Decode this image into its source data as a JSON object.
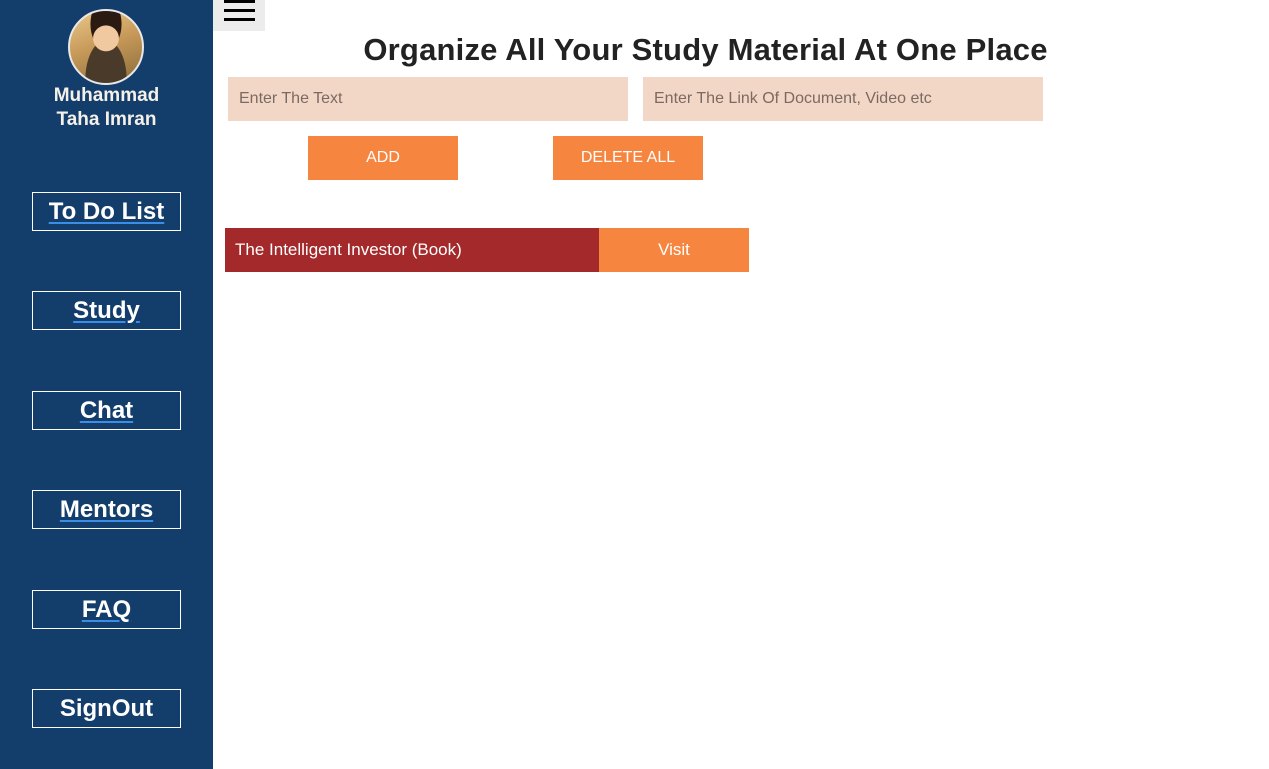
{
  "user": {
    "name": "Muhammad\nTaha Imran"
  },
  "sidebar": {
    "items": [
      {
        "label": "To Do List"
      },
      {
        "label": "Study"
      },
      {
        "label": "Chat"
      },
      {
        "label": "Mentors"
      },
      {
        "label": "FAQ"
      },
      {
        "label": "SignOut"
      }
    ]
  },
  "header": {
    "menu_icon": "hamburger-menu-icon"
  },
  "main": {
    "title": "Organize All Your Study Material At One Place",
    "text_input": {
      "placeholder": "Enter The Text",
      "value": ""
    },
    "link_input": {
      "placeholder": "Enter The Link Of Document, Video etc",
      "value": ""
    },
    "add_label": "ADD",
    "delete_all_label": "DELETE ALL",
    "materials": [
      {
        "title": "The Intelligent Investor (Book)",
        "action_label": "Visit"
      }
    ]
  },
  "colors": {
    "sidebar_bg": "#133d6b",
    "input_bg": "#f3d7c6",
    "accent_orange": "#f6863f",
    "item_red": "#a4292a"
  }
}
